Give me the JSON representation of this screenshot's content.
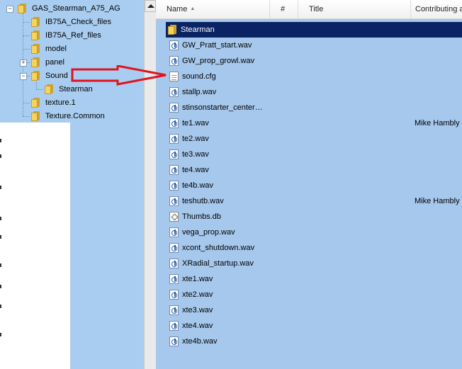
{
  "tree": {
    "root": {
      "label": "GAS_Stearman_A75_AG",
      "expander": "−"
    },
    "items": [
      {
        "label": "IB75A_Check_files"
      },
      {
        "label": "IB75A_Ref_files"
      },
      {
        "label": "model"
      },
      {
        "label": "panel",
        "expander": "+"
      },
      {
        "label": "Sound",
        "expander": "−"
      },
      {
        "label": "Stearman"
      },
      {
        "label": "texture.1"
      },
      {
        "label": "Texture.Common"
      }
    ]
  },
  "list": {
    "columns": {
      "name": "Name",
      "sort_arrow": "▲",
      "number": "#",
      "title": "Title",
      "contributing": "Contributing a"
    },
    "rows": [
      {
        "name": "Stearman",
        "type": "folder",
        "contributing": ""
      },
      {
        "name": "GW_Pratt_start.wav",
        "type": "wav",
        "contributing": ""
      },
      {
        "name": "GW_prop_growl.wav",
        "type": "wav",
        "contributing": ""
      },
      {
        "name": "sound.cfg",
        "type": "cfg",
        "contributing": ""
      },
      {
        "name": "stallp.wav",
        "type": "wav",
        "contributing": ""
      },
      {
        "name": "stinsonstarter_center…",
        "type": "wav",
        "contributing": ""
      },
      {
        "name": "te1.wav",
        "type": "wav",
        "contributing": "Mike Hambly"
      },
      {
        "name": "te2.wav",
        "type": "wav",
        "contributing": ""
      },
      {
        "name": "te3.wav",
        "type": "wav",
        "contributing": ""
      },
      {
        "name": "te4.wav",
        "type": "wav",
        "contributing": ""
      },
      {
        "name": "te4b.wav",
        "type": "wav",
        "contributing": ""
      },
      {
        "name": "teshutb.wav",
        "type": "wav",
        "contributing": "Mike Hambly"
      },
      {
        "name": "Thumbs.db",
        "type": "db",
        "contributing": ""
      },
      {
        "name": "vega_prop.wav",
        "type": "wav",
        "contributing": ""
      },
      {
        "name": "xcont_shutdown.wav",
        "type": "wav",
        "contributing": ""
      },
      {
        "name": "XRadial_startup.wav",
        "type": "wav",
        "contributing": ""
      },
      {
        "name": "xte1.wav",
        "type": "wav",
        "contributing": ""
      },
      {
        "name": "xte2.wav",
        "type": "wav",
        "contributing": ""
      },
      {
        "name": "xte3.wav",
        "type": "wav",
        "contributing": ""
      },
      {
        "name": "xte4.wav",
        "type": "wav",
        "contributing": ""
      },
      {
        "name": "xte4b.wav",
        "type": "wav",
        "contributing": ""
      }
    ]
  },
  "colors": {
    "pane_background": "#a6c8ec",
    "selection": "#0a2463",
    "annotation_arrow": "#e0141e"
  }
}
